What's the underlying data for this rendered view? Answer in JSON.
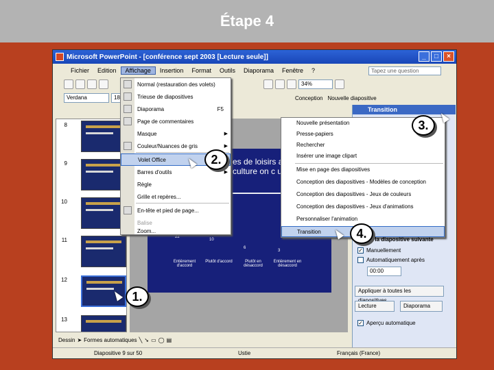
{
  "header": {
    "title": "Étape 4"
  },
  "window": {
    "title": "Microsoft PowerPoint - [conférence sept 2003 [Lecture seule]]",
    "controls": [
      "_",
      "□",
      "×"
    ]
  },
  "menu": [
    "Fichier",
    "Edition",
    "Affichage",
    "Insertion",
    "Format",
    "Outils",
    "Diaporama",
    "Fenêtre",
    "?"
  ],
  "ask_placeholder": "Tapez une question",
  "toolbar": {
    "zoom": "34%",
    "font": "Verdana",
    "size": "18",
    "conception": "Conception",
    "new_slide": "Nouvelle diapositive"
  },
  "view_menu": [
    {
      "label": "Normal (restauration des volets)",
      "shortcut": "",
      "arrow": false,
      "disabled": false,
      "hl": false
    },
    {
      "label": "Trieuse de diapositives",
      "shortcut": "",
      "arrow": false,
      "disabled": false,
      "hl": false
    },
    {
      "label": "Diaporama",
      "shortcut": "F5",
      "arrow": false,
      "disabled": false,
      "hl": false
    },
    {
      "label": "Page de commentaires",
      "shortcut": "",
      "arrow": false,
      "disabled": false,
      "hl": false
    },
    {
      "label": "Masque",
      "shortcut": "",
      "arrow": true,
      "disabled": false,
      "hl": false
    },
    {
      "label": "Couleur/Nuances de gris",
      "shortcut": "",
      "arrow": true,
      "disabled": false,
      "hl": false
    },
    {
      "label": "Volet Office",
      "shortcut": "",
      "arrow": false,
      "disabled": false,
      "hl": true
    },
    {
      "label": "Barres d'outils",
      "shortcut": "",
      "arrow": true,
      "disabled": false,
      "hl": false
    },
    {
      "label": "Règle",
      "shortcut": "",
      "arrow": false,
      "disabled": false,
      "hl": false
    },
    {
      "label": "Grille et repères...",
      "shortcut": "",
      "arrow": false,
      "disabled": false,
      "hl": false
    },
    {
      "label": "En-tête et pied de page...",
      "shortcut": "",
      "arrow": false,
      "disabled": false,
      "hl": false
    },
    {
      "label": "Balise",
      "shortcut": "",
      "arrow": false,
      "disabled": true,
      "hl": false
    },
    {
      "label": "Zoom...",
      "shortcut": "",
      "arrow": false,
      "disabled": false,
      "hl": false
    }
  ],
  "task_pane": {
    "title": "Transition",
    "items": [
      "Nouvelle présentation",
      "Presse-papiers",
      "Rechercher",
      "Insérer une image clipart",
      "Mise en page des diapositives",
      "Conception des diapositives - Modèles de conception",
      "Conception des diapositives - Jeux de couleurs",
      "Conception des diapositives - Jeux d'animations",
      "Personnaliser l'animation",
      "Transition"
    ],
    "next_slide": "e à la diapositive suivante",
    "manual": "Manuellement",
    "auto_after": "Automatiquement après",
    "time": "00:00",
    "apply_all": "Appliquer à toutes les diapositives",
    "play": "Lecture",
    "slideshow": "Diaporama",
    "auto_preview": "Aperçu automatique"
  },
  "slide": {
    "title": "es de loisirs a es de culture on c ultifonctionnel",
    "chart_labels": [
      "Entièrement d'accord",
      "Plutôt d'accord",
      "Plutôt en désaccord",
      "Entièrement en désaccord"
    ],
    "chart_values": [
      "22",
      "10",
      "6",
      "3"
    ]
  },
  "thumbs": [
    "8",
    "9",
    "10",
    "11",
    "12",
    "13"
  ],
  "drawbar": {
    "dessin": "Dessin",
    "formes": "Formes automatiques"
  },
  "status": {
    "slide": "Diapositive 9 sur 50",
    "design": "Ustie",
    "lang": "Français (France)"
  },
  "callouts": [
    "1.",
    "2.",
    "3.",
    "4."
  ]
}
